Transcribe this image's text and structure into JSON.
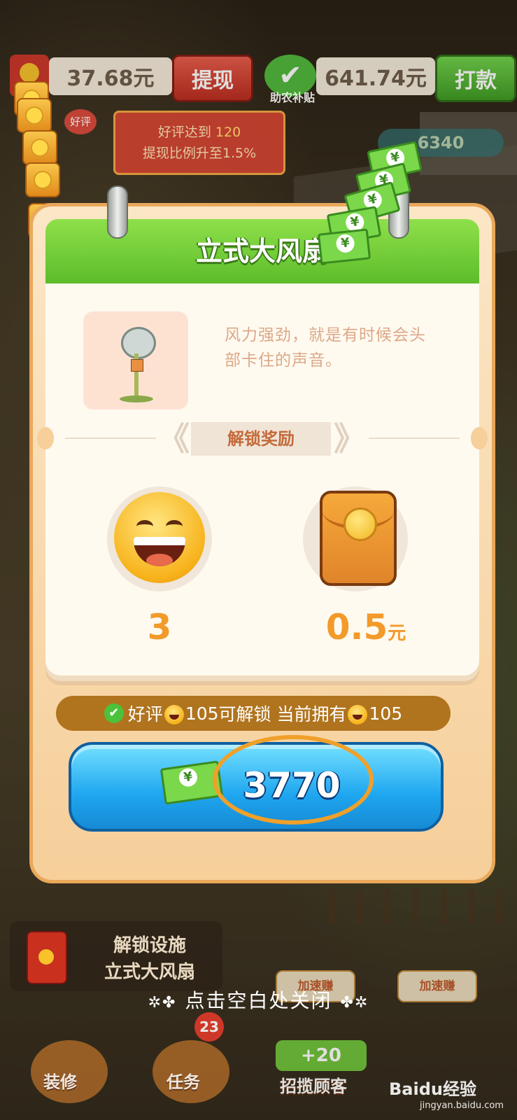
{
  "topbar": {
    "cash_balance": "37.68元",
    "withdraw_label": "提现",
    "subsidy_label": "助农补贴",
    "subsidy_balance": "641.74元",
    "payout_label": "打款",
    "good_review_badge": "好评",
    "tooltip_line1_prefix": "好评达到",
    "tooltip_line1_value": "120",
    "tooltip_line2": "提现比例升至1.5%",
    "green_cash": "6340"
  },
  "modal": {
    "title": "立式大风扇",
    "description": "风力强劲，就是有时候会头部卡住的声音。",
    "rewards_header": "解锁奖励",
    "rewards": [
      {
        "icon": "smiley-emoji-icon",
        "value": "3",
        "unit": ""
      },
      {
        "icon": "red-packet-icon",
        "value": "0.5",
        "unit": "元"
      }
    ],
    "unlock_prefix": "好评",
    "unlock_required": "105",
    "unlock_mid": "可解锁 当前拥有",
    "unlock_owned": "105",
    "price": "3770"
  },
  "hud": {
    "notify_line1": "解锁设施",
    "notify_line2": "立式大风扇",
    "close_hint": "点击空白处关闭",
    "speed_label": "加速赚",
    "task_count": "23",
    "plus_bonus": "+20",
    "bottom_left": "装修",
    "bottom_mid": "任务",
    "bottom_right": "招揽顾客"
  },
  "watermark": {
    "brand": "Baidu经验",
    "url": "jingyan.baidu.com"
  },
  "colors": {
    "header_green": "#5dbc2a",
    "button_blue": "#1ea6ef",
    "accent_orange": "#f29a2a",
    "highlight_ring": "#f0a02a"
  }
}
